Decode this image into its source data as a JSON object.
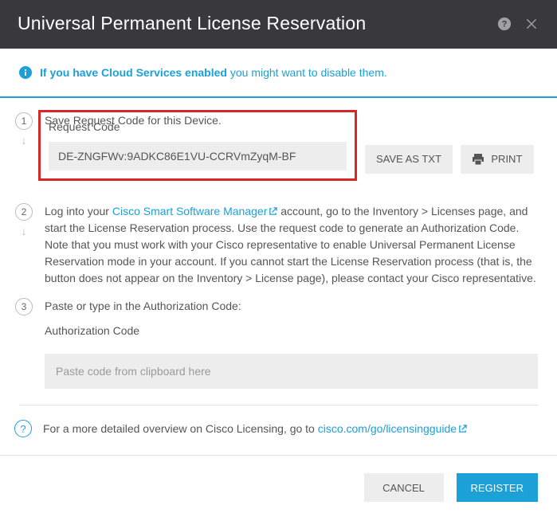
{
  "header": {
    "title": "Universal Permanent License Reservation"
  },
  "info": {
    "bold": "If you have Cloud Services enabled",
    "rest": " you might want to disable them."
  },
  "steps": {
    "s1": {
      "num": "1",
      "title": "Save Request Code for this Device.",
      "field_label": "Request Code",
      "code_value": "DE-ZNGFWv:9ADKC86E1VU-CCRVmZyqM-BF",
      "save_btn": "SAVE AS TXT",
      "print_btn": "PRINT"
    },
    "s2": {
      "num": "2",
      "pre": "Log into your ",
      "link": "Cisco Smart Software Manager",
      "post": " account, go to the Inventory > Licenses page, and start the License Reservation process. Use the request code to generate an Authorization Code. Note that you must work with your Cisco representative to enable Universal Permanent License Reservation mode in your account. If you cannot start the License Reservation process (that is, the button does not appear on the Inventory > License page), please contact your Cisco representative."
    },
    "s3": {
      "num": "3",
      "title": "Paste or type in the Authorization Code:",
      "field_label": "Authorization Code",
      "placeholder": "Paste code from clipboard here"
    }
  },
  "help": {
    "text": "For a more detailed overview on Cisco Licensing, go to ",
    "link": "cisco.com/go/licensingguide"
  },
  "footer": {
    "cancel": "CANCEL",
    "register": "REGISTER"
  }
}
